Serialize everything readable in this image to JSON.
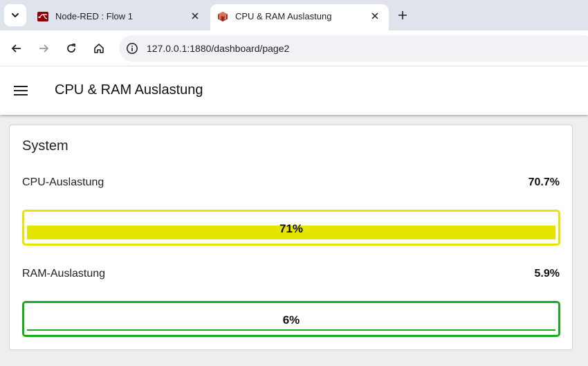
{
  "browser": {
    "tabs": [
      {
        "title": "Node-RED : Flow 1",
        "icon": "node-red-icon",
        "active": false
      },
      {
        "title": "CPU & RAM Auslastung",
        "icon": "dashboard-cube-icon",
        "active": true
      }
    ],
    "url": "127.0.0.1:1880/dashboard/page2"
  },
  "header": {
    "title": "CPU & RAM Auslastung"
  },
  "group": {
    "title": "System"
  },
  "metrics": {
    "cpu": {
      "label": "CPU-Auslastung",
      "value_text": "70.7%",
      "gauge_text": "71%",
      "fraction": 0.707,
      "color": "#e5e500"
    },
    "ram": {
      "label": "RAM-Auslastung",
      "value_text": "5.9%",
      "gauge_text": "6%",
      "fraction": 0.059,
      "color": "#1aab1a"
    }
  }
}
